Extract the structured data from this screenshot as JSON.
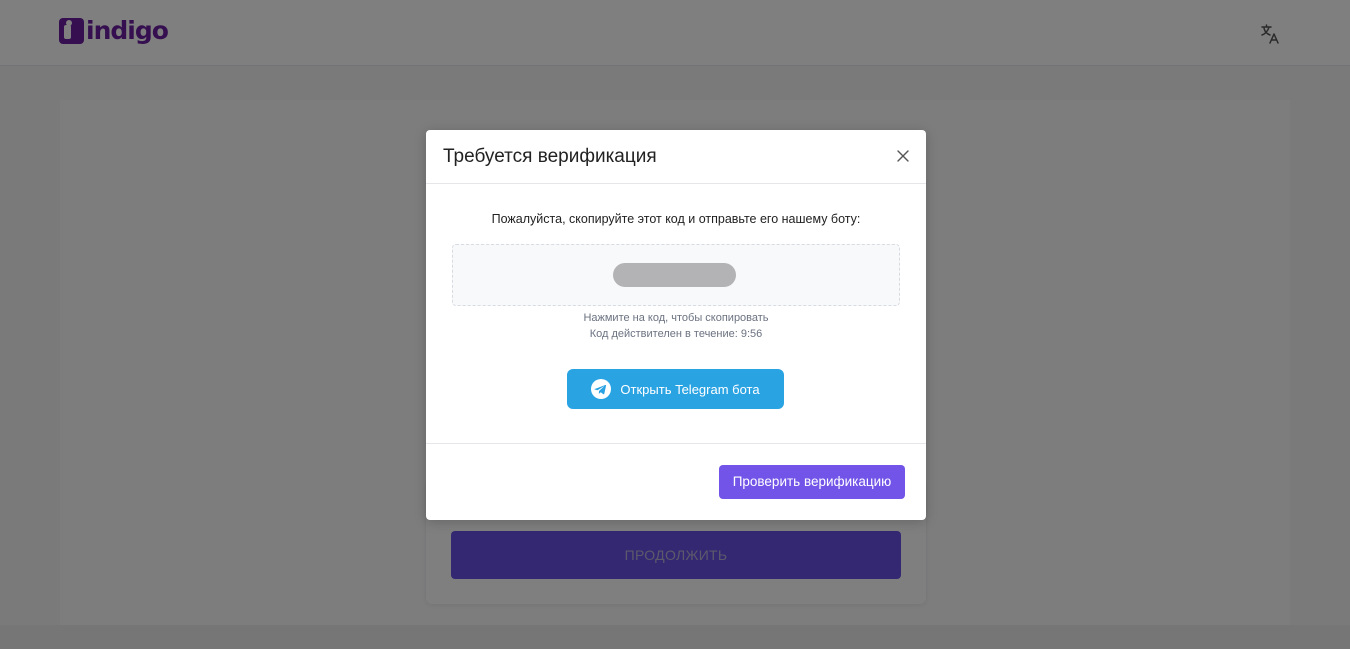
{
  "header": {
    "brand": "indigo",
    "brand_color": "#6a1f9e",
    "language_icon": "translate-icon"
  },
  "main": {
    "continue_label": "ПРОДОЛЖИТЬ"
  },
  "modal": {
    "title": "Требуется верификация",
    "close_icon": "close-icon",
    "instruction": "Пожалуйста, скопируйте этот код и отправьте его нашему боту:",
    "copy_hint": "Нажмите на код, чтобы скопировать",
    "validity_text": "Код действителен в течение: 9:56",
    "telegram_button": "Открыть Telegram бота",
    "telegram_icon": "telegram-icon",
    "telegram_color": "#2aa3e3",
    "verify_button": "Проверить верификацию",
    "verify_color": "#7254e8"
  }
}
